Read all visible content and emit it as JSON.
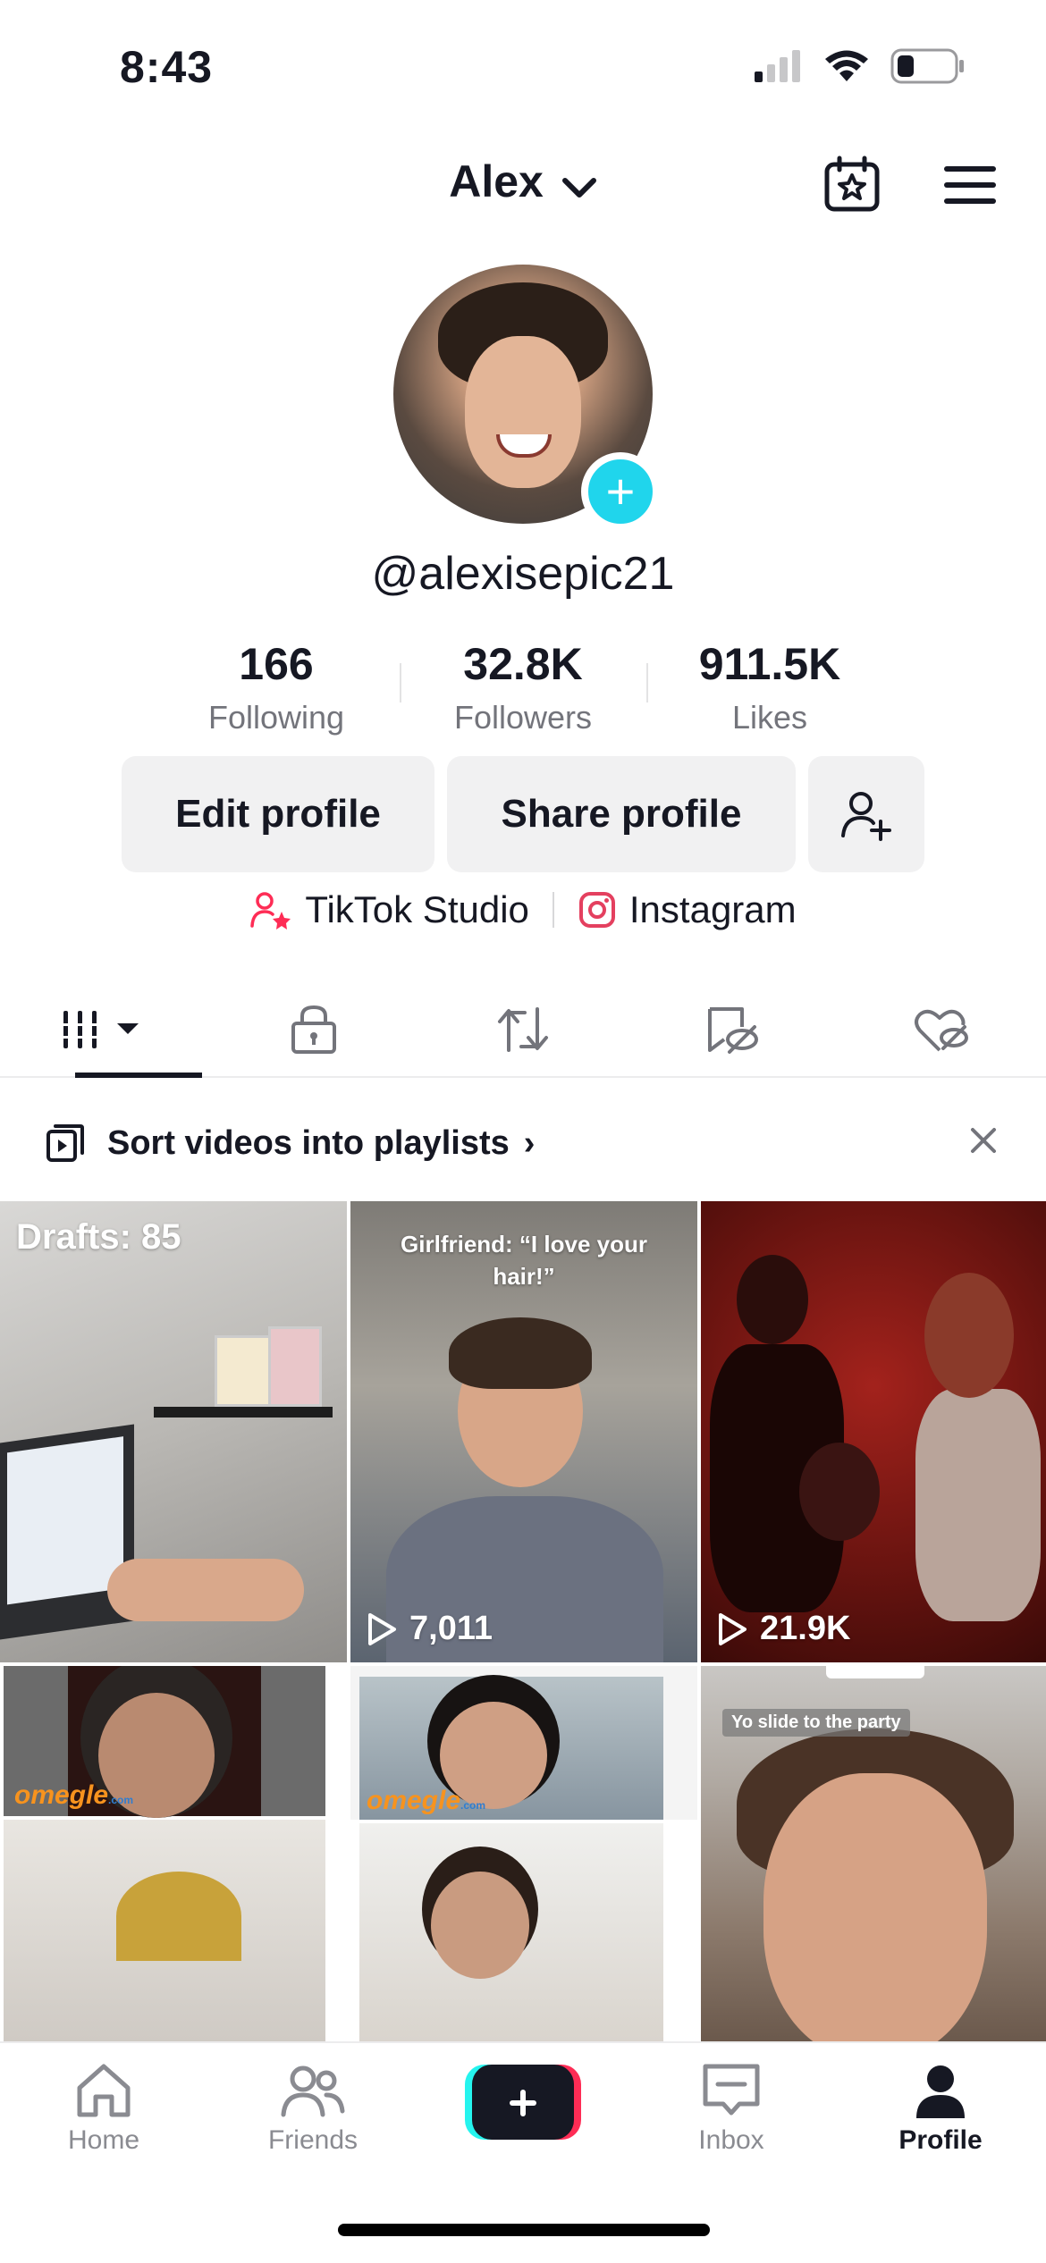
{
  "status_bar": {
    "time": "8:43"
  },
  "header": {
    "account_name": "Alex"
  },
  "profile": {
    "handle": "@alexisepic21",
    "stats": [
      {
        "value": "166",
        "label": "Following"
      },
      {
        "value": "32.8K",
        "label": "Followers"
      },
      {
        "value": "911.5K",
        "label": "Likes"
      }
    ]
  },
  "actions": {
    "edit_label": "Edit profile",
    "share_label": "Share profile"
  },
  "links": {
    "studio": "TikTok Studio",
    "instagram": "Instagram"
  },
  "playlist_banner": {
    "text": "Sort videos into playlists",
    "chevron": "›"
  },
  "videos": [
    {
      "overlay": "Drafts: 85"
    },
    {
      "caption": "Girlfriend: “I love your hair!”",
      "views": "7,011"
    },
    {
      "views": "21.9K"
    },
    {
      "watermark": "omegle",
      "watermark_suffix": ".com"
    },
    {
      "watermark": "omegle",
      "watermark_suffix": ".com"
    },
    {
      "caption": "Yo slide to the party"
    }
  ],
  "tabbar": {
    "home": "Home",
    "friends": "Friends",
    "inbox": "Inbox",
    "profile": "Profile"
  },
  "colors": {
    "accent_cyan": "#20d5ec",
    "accent_pink": "#fe2c55",
    "text_primary": "#161823",
    "text_secondary": "#73747b",
    "button_bg": "#f1f1f2"
  },
  "icons": {
    "status": [
      "cellular-signal-icon",
      "wifi-icon",
      "battery-icon"
    ],
    "header": [
      "calendar-star-icon",
      "hamburger-menu-icon"
    ],
    "tabs": [
      "videos-grid-icon",
      "private-lock-icon",
      "reposts-icon",
      "favorites-icon",
      "liked-icon"
    ]
  }
}
